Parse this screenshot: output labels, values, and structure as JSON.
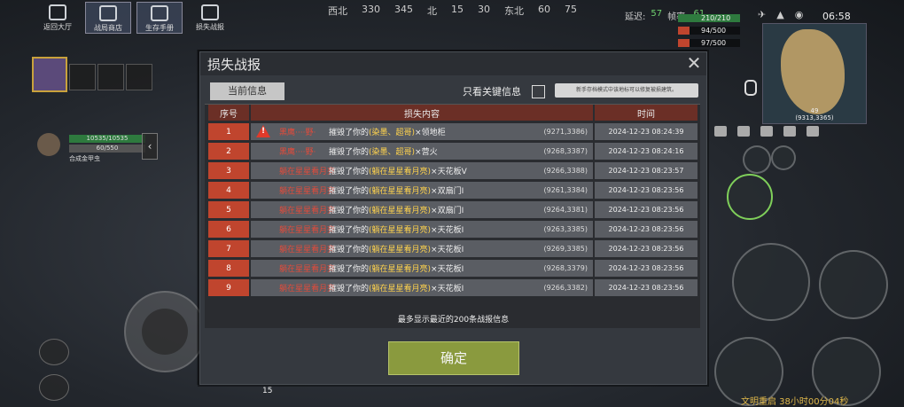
{
  "top_menu": {
    "lobby": "返回大厅",
    "store": "战局商店",
    "manual": "生存手册",
    "loss_report": "损失战报"
  },
  "compass": [
    "西北",
    "330",
    "345",
    "北",
    "15",
    "30",
    "东北",
    "60",
    "75"
  ],
  "status": {
    "delay_label": "延迟:",
    "delay_value": "57",
    "fps_label": "帧率:",
    "fps_value": "61",
    "hp": "210/210",
    "food": "94/500",
    "water": "97/500",
    "clock": "06:58"
  },
  "minimap": {
    "number": "49",
    "coord": "(9313,3365)"
  },
  "player": {
    "hp": "10535/10535",
    "sub": "60/550",
    "item": "合成金甲虫"
  },
  "rebuild_text": "文明重启  38小时00分04秒",
  "bottom_number": "15",
  "dialog": {
    "title": "损失战报",
    "tab_current": "当前信息",
    "key_only": "只看关键信息",
    "tip": "新手存档模式中该地标可以修复被损建筑。",
    "headers": {
      "index": "序号",
      "content": "损失内容",
      "time": "时间"
    },
    "rows": [
      {
        "idx": "1",
        "attacker": "黑鹰····野·",
        "action": "摧毁了你的",
        "guild": "(染墨、超哥)",
        "target": "×领地柜",
        "coord": "(9271,3386)",
        "time": "2024-12-23 08:24:39",
        "warn": true
      },
      {
        "idx": "2",
        "attacker": "黑鹰····野·",
        "action": "摧毁了你的",
        "guild": "(染墨、超哥)",
        "target": "×营火",
        "coord": "(9268,3387)",
        "time": "2024-12-23 08:24:16",
        "warn": false
      },
      {
        "idx": "3",
        "attacker": "躺在星星看月亮",
        "action": "摧毁了你的",
        "guild": "(躺在星星看月亮)",
        "target": "×天花板V",
        "coord": "(9266,3388)",
        "time": "2024-12-23 08:23:57",
        "warn": false
      },
      {
        "idx": "4",
        "attacker": "躺在星星看月亮",
        "action": "摧毁了你的",
        "guild": "(躺在星星看月亮)",
        "target": "×双扇门I",
        "coord": "(9261,3384)",
        "time": "2024-12-23 08:23:56",
        "warn": false
      },
      {
        "idx": "5",
        "attacker": "躺在星星看月亮",
        "action": "摧毁了你的",
        "guild": "(躺在星星看月亮)",
        "target": "×双扇门I",
        "coord": "(9264,3381)",
        "time": "2024-12-23 08:23:56",
        "warn": false
      },
      {
        "idx": "6",
        "attacker": "躺在星星看月亮",
        "action": "摧毁了你的",
        "guild": "(躺在星星看月亮)",
        "target": "×天花板I",
        "coord": "(9263,3385)",
        "time": "2024-12-23 08:23:56",
        "warn": false
      },
      {
        "idx": "7",
        "attacker": "躺在星星看月亮",
        "action": "摧毁了你的",
        "guild": "(躺在星星看月亮)",
        "target": "×天花板I",
        "coord": "(9269,3385)",
        "time": "2024-12-23 08:23:56",
        "warn": false
      },
      {
        "idx": "8",
        "attacker": "躺在星星看月亮",
        "action": "摧毁了你的",
        "guild": "(躺在星星看月亮)",
        "target": "×天花板I",
        "coord": "(9268,3379)",
        "time": "2024-12-23 08:23:56",
        "warn": false
      },
      {
        "idx": "9",
        "attacker": "躺在星星看月亮",
        "action": "摧毁了你的",
        "guild": "(躺在星星看月亮)",
        "target": "×天花板I",
        "coord": "(9266,3382)",
        "time": "2024-12-23 08:23:56",
        "warn": false
      }
    ],
    "footer": "最多显示最近的200条战报信息",
    "confirm": "确定"
  },
  "colors": {
    "accent_red": "#c0452e",
    "header_red": "#6b2f26",
    "guild_yellow": "#ffd34d",
    "confirm_green": "#8a9a3e"
  }
}
